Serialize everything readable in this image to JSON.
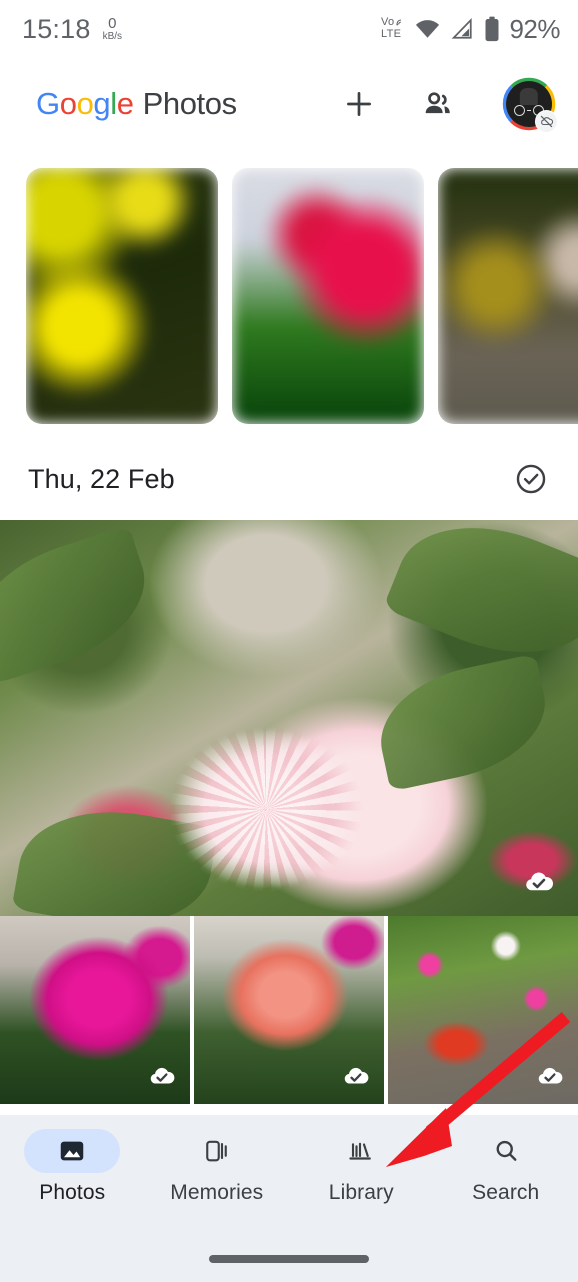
{
  "status_bar": {
    "time": "15:18",
    "network_speed_value": "0",
    "network_speed_unit": "kB/s",
    "volte_line1": "Vo",
    "volte_line2": "LTE",
    "wifi_icon": "wifi-icon",
    "signal_icon": "cellular-signal-icon",
    "battery_icon": "battery-icon",
    "battery_percent": "92%"
  },
  "app_bar": {
    "logo": {
      "word1_letters": [
        "G",
        "o",
        "o",
        "g",
        "l",
        "e"
      ],
      "word2": "Photos"
    },
    "add_button_label": "+",
    "add_icon": "plus-icon",
    "sharing_icon": "people-sharing-icon",
    "avatar_icon": "account-avatar",
    "avatar_badge_icon": "backup-off-icon"
  },
  "memories": {
    "section_name": "memories-carousel",
    "cards": [
      {
        "name": "memory-card-yellow-flowers",
        "alt": "Blurred yellow flowers memory"
      },
      {
        "name": "memory-card-pink-flower",
        "alt": "Blurred pink flower memory"
      },
      {
        "name": "memory-card-garden",
        "alt": "Blurred garden memory"
      }
    ]
  },
  "date_section": {
    "label": "Thu, 22 Feb",
    "select_icon": "circle-check-select-icon"
  },
  "photo_grid": {
    "hero": {
      "name": "photo-hero-pink-dahlia",
      "alt": "Pink and white dahlia flower",
      "backup_icon": "cloud-check-icon"
    },
    "thumbnails": [
      {
        "name": "photo-thumb-magenta-dahlia",
        "alt": "Magenta dahlia flower",
        "backup_icon": "cloud-check-icon"
      },
      {
        "name": "photo-thumb-coral-dahlia",
        "alt": "Coral dahlia flower",
        "backup_icon": "cloud-check-icon"
      },
      {
        "name": "photo-thumb-petunias",
        "alt": "Pink and white petunias in a pot",
        "backup_icon": "cloud-check-icon"
      }
    ]
  },
  "annotation": {
    "arrow_color": "#EE1C22",
    "arrow_target": "Library",
    "name": "red-pointer-arrow"
  },
  "bottom_nav": {
    "items": [
      {
        "label": "Photos",
        "icon": "photos-image-icon",
        "active": true
      },
      {
        "label": "Memories",
        "icon": "memories-cards-icon",
        "active": false
      },
      {
        "label": "Library",
        "icon": "library-books-icon",
        "active": false
      },
      {
        "label": "Search",
        "icon": "search-magnifier-icon",
        "active": false
      }
    ],
    "active_pill_color": "#D3E3FD",
    "background_color": "#ECF0F4",
    "home_indicator": "home-gesture-bar"
  }
}
